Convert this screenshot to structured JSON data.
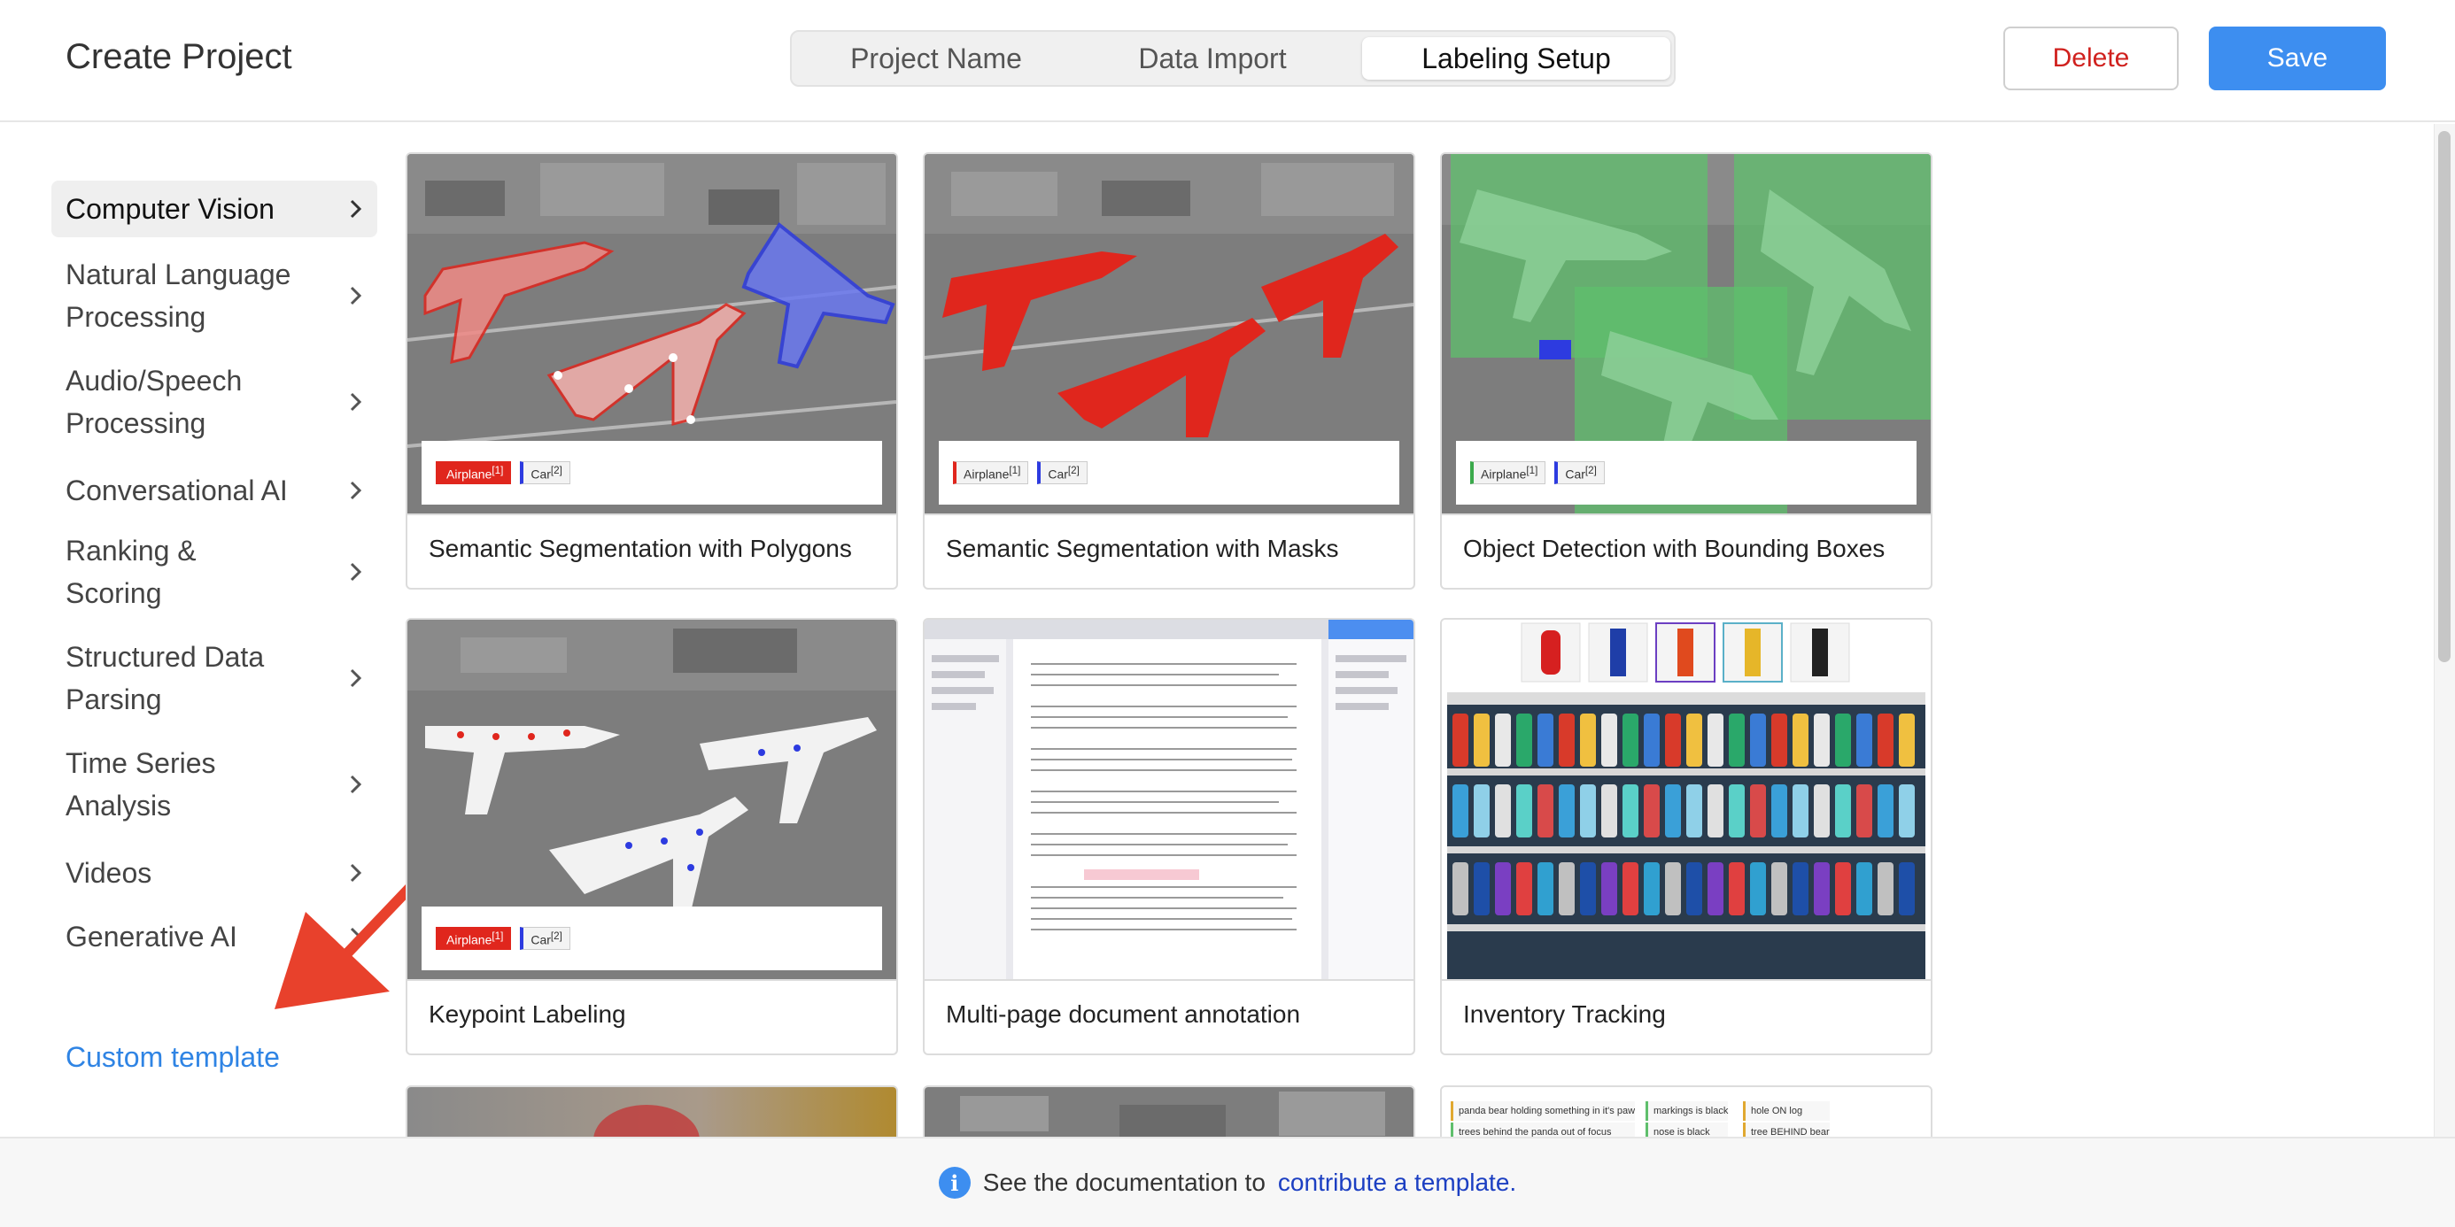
{
  "header": {
    "title": "Create Project",
    "tabs": [
      {
        "label": "Project Name",
        "active": false
      },
      {
        "label": "Data Import",
        "active": false
      },
      {
        "label": "Labeling Setup",
        "active": true
      }
    ],
    "delete_label": "Delete",
    "save_label": "Save"
  },
  "sidebar": {
    "items": [
      {
        "label": "Computer Vision",
        "active": true
      },
      {
        "label": "Natural Language Processing",
        "active": false
      },
      {
        "label": "Audio/Speech Processing",
        "active": false
      },
      {
        "label": "Conversational AI",
        "active": false
      },
      {
        "label": "Ranking & Scoring",
        "active": false
      },
      {
        "label": "Structured Data Parsing",
        "active": false
      },
      {
        "label": "Time Series Analysis",
        "active": false
      },
      {
        "label": "Videos",
        "active": false
      },
      {
        "label": "Generative AI",
        "active": false
      }
    ],
    "custom_template_label": "Custom template"
  },
  "templates": [
    {
      "title": "Semantic Segmentation with Polygons",
      "chips": [
        "Airplane",
        "Car"
      ]
    },
    {
      "title": "Semantic Segmentation with Masks",
      "chips": [
        "Airplane",
        "Car"
      ]
    },
    {
      "title": "Object Detection with Bounding Boxes",
      "chips": [
        "Airplane",
        "Car"
      ]
    },
    {
      "title": "Keypoint Labeling",
      "chips": [
        "Airplane",
        "Car"
      ]
    },
    {
      "title": "Multi-page document annotation",
      "chips": []
    },
    {
      "title": "Inventory Tracking",
      "chips": []
    },
    {
      "title": "",
      "chips": []
    },
    {
      "title": "",
      "chips": []
    },
    {
      "title": "",
      "chips": []
    }
  ],
  "chip_labels": {
    "airplane": "Airplane",
    "car": "Car",
    "sup1": "[1]",
    "sup2": "[2]"
  },
  "relations_preview": {
    "regions": [
      "panda bear holding something in it's paw",
      "trees behind the panda out of focus"
    ],
    "attributes": [
      "markings is black",
      "nose is black"
    ],
    "relationships": [
      "hole ON log",
      "tree BEHIND bear"
    ]
  },
  "footer": {
    "text": "See the documentation to",
    "link": "contribute a template."
  },
  "colors": {
    "accent": "#3d8ef0",
    "delete": "#d0211e",
    "link": "#2f84e4",
    "polygon_red": "#e0261d",
    "polygon_blue": "#2d3be0",
    "bbox_green": "#5fbf6c"
  }
}
